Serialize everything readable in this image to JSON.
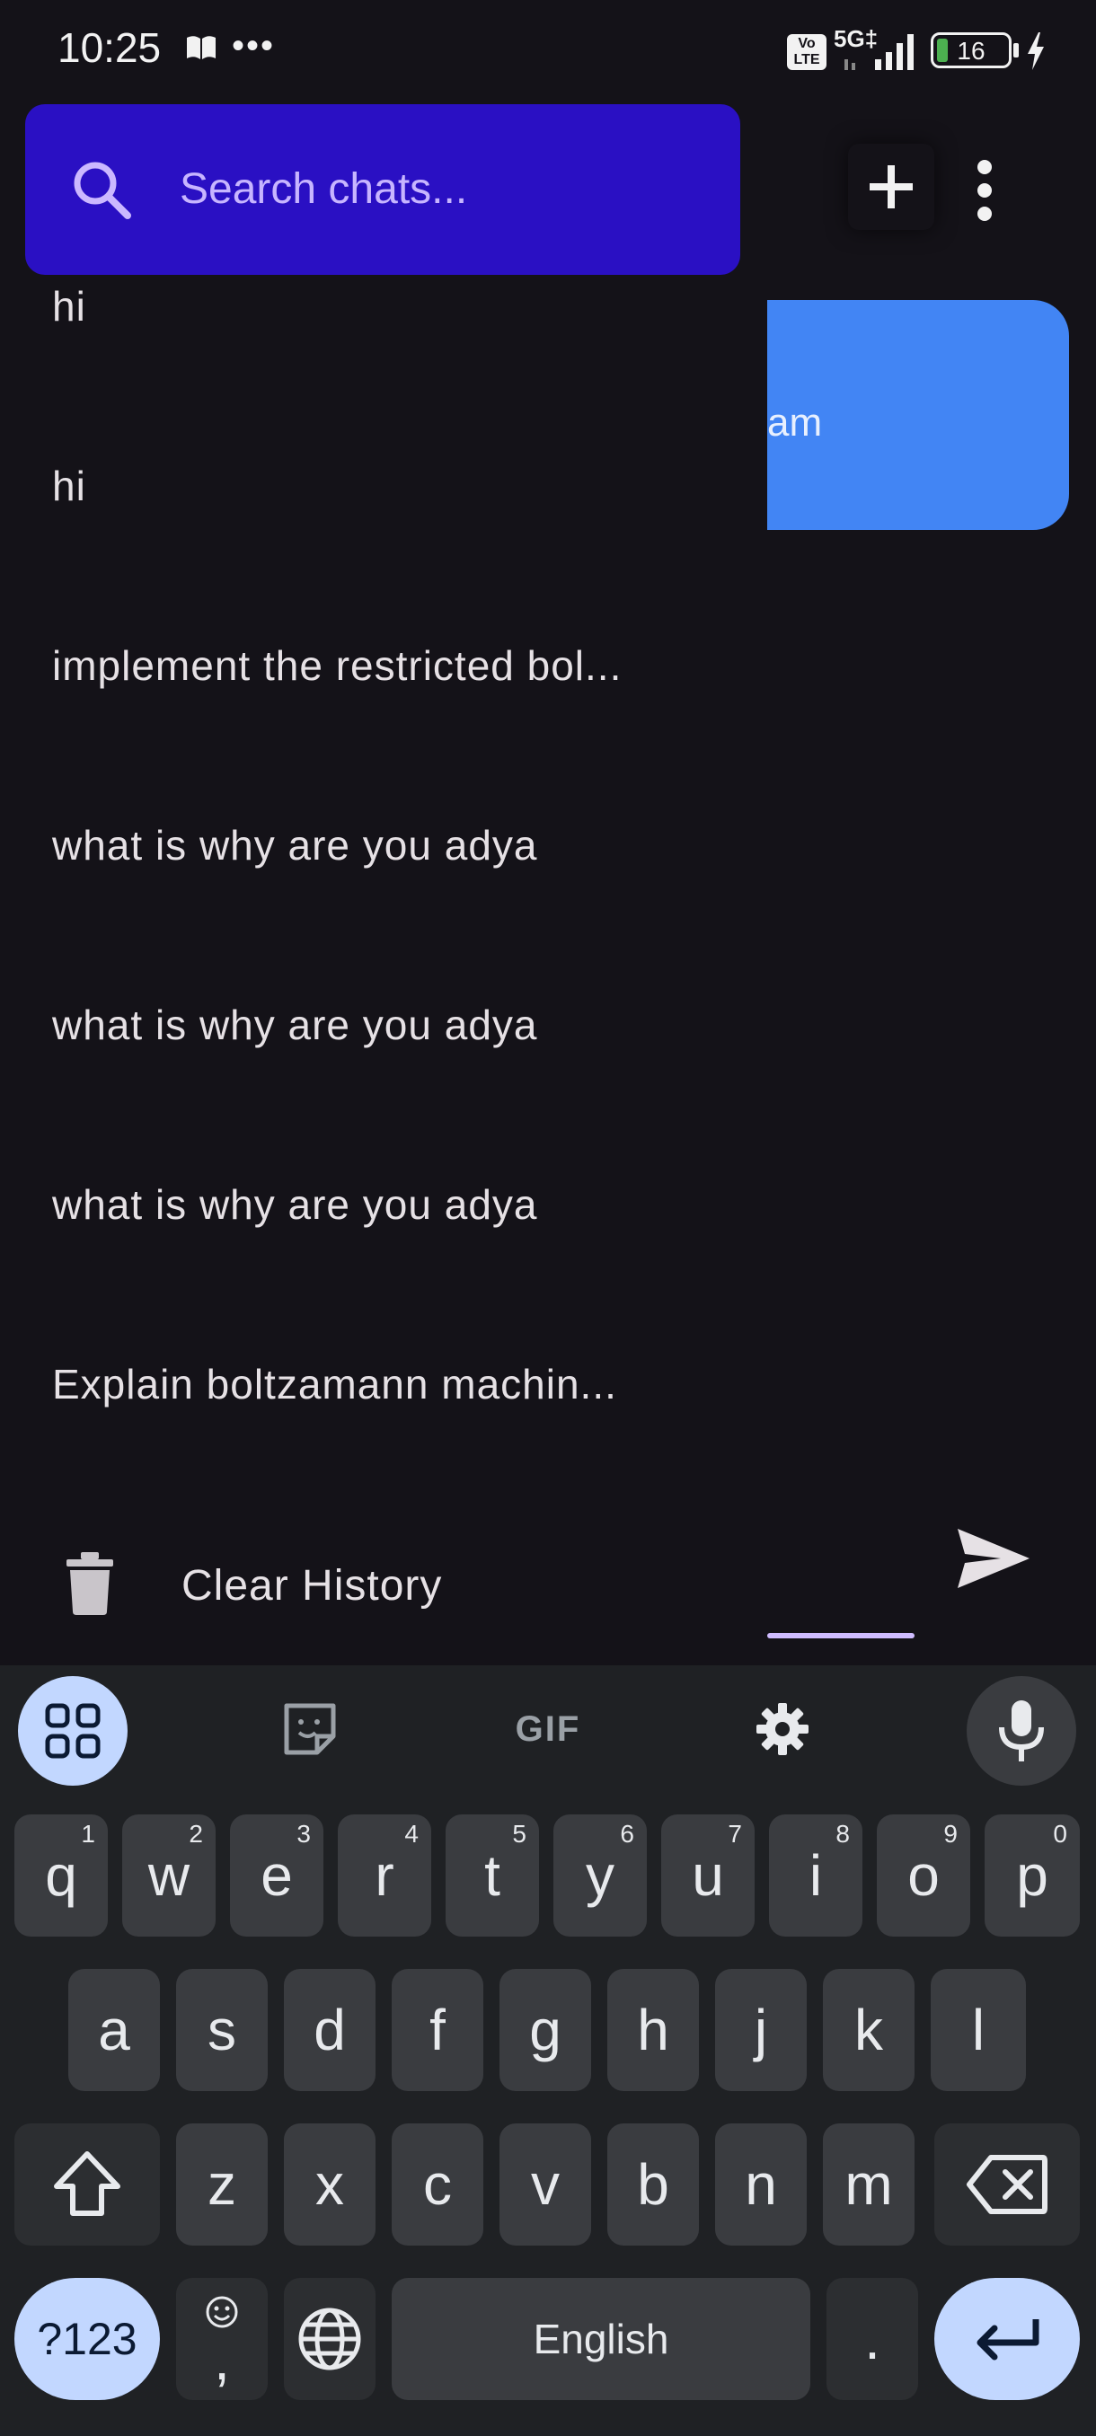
{
  "status_bar": {
    "time": "10:25",
    "dots": "•••",
    "volte": "Vo LTE",
    "network": "5G‡",
    "battery": "16"
  },
  "search": {
    "placeholder": "Search chats..."
  },
  "chat": {
    "bubble_text": "am"
  },
  "history": {
    "items": [
      {
        "label": "hi"
      },
      {
        "label": "hi"
      },
      {
        "label": "implement the restricted bol..."
      },
      {
        "label": "what is why are you adya"
      },
      {
        "label": "what is why are you adya"
      },
      {
        "label": "what is why are you adya"
      },
      {
        "label": "Explain boltzamann machin..."
      }
    ],
    "clear_label": "Clear History"
  },
  "keyboard": {
    "row1": [
      {
        "key": "q",
        "hint": "1"
      },
      {
        "key": "w",
        "hint": "2"
      },
      {
        "key": "e",
        "hint": "3"
      },
      {
        "key": "r",
        "hint": "4"
      },
      {
        "key": "t",
        "hint": "5"
      },
      {
        "key": "y",
        "hint": "6"
      },
      {
        "key": "u",
        "hint": "7"
      },
      {
        "key": "i",
        "hint": "8"
      },
      {
        "key": "o",
        "hint": "9"
      },
      {
        "key": "p",
        "hint": "0"
      }
    ],
    "row2": [
      "a",
      "s",
      "d",
      "f",
      "g",
      "h",
      "j",
      "k",
      "l"
    ],
    "row3": [
      "z",
      "x",
      "c",
      "v",
      "b",
      "n",
      "m"
    ],
    "symbols_label": "?123",
    "comma_label": ",",
    "space_label": "English",
    "period_label": ".",
    "colors": {
      "key": "#3a3c40",
      "accent": "#c2d7ff",
      "background": "#1f2124"
    }
  },
  "colors": {
    "background": "#141218",
    "search_bar": "#2a10c3",
    "chat_bubble": "#4285f4",
    "underline": "#d0bcff"
  }
}
